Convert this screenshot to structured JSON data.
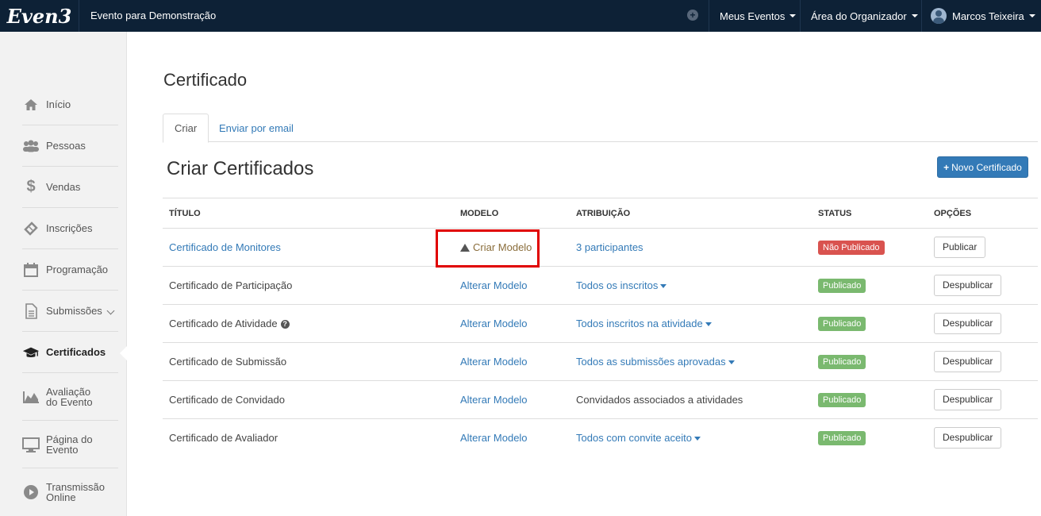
{
  "brand": {
    "logo": "Even3"
  },
  "header": {
    "event_name": "Evento para Demonstração",
    "menu_meus_eventos": "Meus Eventos",
    "menu_organizador": "Área do Organizador",
    "user_name": "Marcos Teixeira"
  },
  "sidebar": {
    "items": [
      {
        "label": "Início",
        "icon": "home-icon"
      },
      {
        "label": "Pessoas",
        "icon": "users-icon"
      },
      {
        "label": "Vendas",
        "icon": "dollar-icon"
      },
      {
        "label": "Inscrições",
        "icon": "ticket-icon"
      },
      {
        "label": "Programação",
        "icon": "calendar-icon"
      },
      {
        "label": "Submissões",
        "icon": "file-icon"
      },
      {
        "label": "Certificados",
        "icon": "graduation-cap-icon"
      },
      {
        "label_line1": "Avaliação",
        "label_line2": "do Evento",
        "icon": "area-chart-icon"
      },
      {
        "label_line1": "Página do",
        "label_line2": "Evento",
        "icon": "monitor-icon"
      },
      {
        "label_line1": "Transmissão",
        "label_line2": "Online",
        "icon": "play-icon"
      }
    ]
  },
  "page": {
    "title": "Certificado",
    "tabs": [
      {
        "label": "Criar"
      },
      {
        "label": "Enviar por email"
      }
    ],
    "section_title": "Criar Certificados",
    "new_button": "Novo Certificado"
  },
  "table": {
    "columns": [
      "TÍTULO",
      "MODELO",
      "ATRIBUIÇÃO",
      "STATUS",
      "OPÇÕES"
    ],
    "rows": [
      {
        "title": "Certificado de Monitores",
        "model": "Criar Modelo",
        "attribution": "3 participantes",
        "status": "Não Publicado",
        "action": "Publicar"
      },
      {
        "title": "Certificado de Participação",
        "model": "Alterar Modelo",
        "attribution": "Todos os inscritos",
        "status": "Publicado",
        "action": "Despublicar"
      },
      {
        "title": "Certificado de Atividade",
        "model": "Alterar Modelo",
        "attribution": "Todos inscritos na atividade",
        "status": "Publicado",
        "action": "Despublicar"
      },
      {
        "title": "Certificado de Submissão",
        "model": "Alterar Modelo",
        "attribution": "Todos as submissões aprovadas",
        "status": "Publicado",
        "action": "Despublicar"
      },
      {
        "title": "Certificado de Convidado",
        "model": "Alterar Modelo",
        "attribution": "Convidados associados a atividades",
        "status": "Publicado",
        "action": "Despublicar"
      },
      {
        "title": "Certificado de Avaliador",
        "model": "Alterar Modelo",
        "attribution": "Todos com convite aceito",
        "status": "Publicado",
        "action": "Despublicar"
      }
    ]
  },
  "colors": {
    "nav_bg": "#0d2136",
    "primary": "#337ab7",
    "danger": "#d9534f",
    "success": "#7ab96f",
    "highlight": "#e00000"
  }
}
